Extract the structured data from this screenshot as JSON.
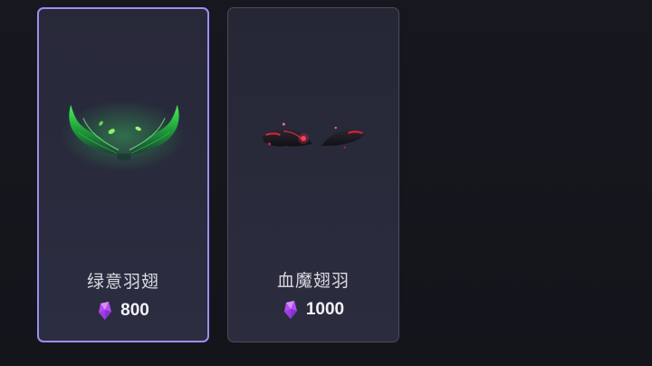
{
  "shop": {
    "items": [
      {
        "name": "绿意羽翅",
        "price": "800",
        "currency_icon": "purple-gem-icon",
        "selected": true,
        "wing_color": "#2fd24a"
      },
      {
        "name": "血魔翅羽",
        "price": "1000",
        "currency_icon": "purple-gem-icon",
        "selected": false,
        "wing_color": "#e0203a"
      }
    ]
  },
  "colors": {
    "background": "#16161d",
    "card": "#2a2b3c",
    "selected_border": "#9d8ef0",
    "gem": "#b44df0"
  }
}
